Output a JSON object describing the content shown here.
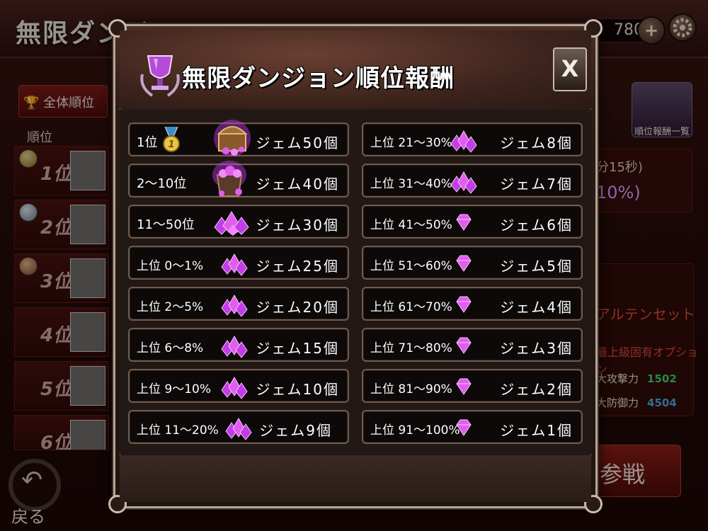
{
  "background": {
    "title": "無限ダンジョン",
    "counter": "780",
    "plus_label": "+",
    "all_rank_tab": "全体順位",
    "rank_header": "順位",
    "ranks": [
      "1位",
      "2位",
      "3位",
      "4位",
      "5位",
      "6位"
    ],
    "reward_list_button": "順位報酬一覧",
    "timer_text": "分15秒)",
    "percent_text": "10%)",
    "equip_name": "アルテンセット",
    "equip_option": "最上級固有オプション",
    "stats": [
      {
        "label": "大攻撃力",
        "value": "1502",
        "color": "#3fd06a"
      },
      {
        "label": "大防御力",
        "value": "4504",
        "color": "#4aa8e8"
      }
    ],
    "battle_button": "参戦",
    "back_button": "戻る"
  },
  "modal": {
    "title": "無限ダンジョン順位報酬",
    "close_label": "X",
    "left_rewards": [
      {
        "rank": "1位",
        "reward": "ジェム50個",
        "icon": "chest-gems-icon"
      },
      {
        "rank": "2〜10位",
        "reward": "ジェム40個",
        "icon": "pot-gems-icon"
      },
      {
        "rank": "11〜50位",
        "reward": "ジェム30個",
        "icon": "gem-pile-icon"
      },
      {
        "rank": "上位 0〜1%",
        "reward": "ジェム25個",
        "icon": "gem-cluster-icon"
      },
      {
        "rank": "上位 2〜5%",
        "reward": "ジェム20個",
        "icon": "gem-cluster-icon"
      },
      {
        "rank": "上位 6〜8%",
        "reward": "ジェム15個",
        "icon": "gem-cluster-icon"
      },
      {
        "rank": "上位 9〜10%",
        "reward": "ジェム10個",
        "icon": "gem-cluster-icon"
      },
      {
        "rank": "上位 11〜20%",
        "reward": "ジェム9個",
        "icon": "gem-cluster-icon"
      }
    ],
    "right_rewards": [
      {
        "rank": "上位 21〜30%",
        "reward": "ジェム8個",
        "icon": "gem-cluster-icon"
      },
      {
        "rank": "上位 31〜40%",
        "reward": "ジェム7個",
        "icon": "gem-cluster-icon"
      },
      {
        "rank": "上位 41〜50%",
        "reward": "ジェム6個",
        "icon": "gem-single-icon"
      },
      {
        "rank": "上位 51〜60%",
        "reward": "ジェム5個",
        "icon": "gem-single-icon"
      },
      {
        "rank": "上位 61〜70%",
        "reward": "ジェム4個",
        "icon": "gem-single-icon"
      },
      {
        "rank": "上位 71〜80%",
        "reward": "ジェム3個",
        "icon": "gem-single-icon"
      },
      {
        "rank": "上位 81〜90%",
        "reward": "ジェム2個",
        "icon": "gem-single-icon"
      },
      {
        "rank": "上位 91〜100%",
        "reward": "ジェム1個",
        "icon": "gem-single-icon"
      }
    ]
  },
  "colors": {
    "gem": "#e35cf0",
    "frame": "#b5a694",
    "row_bg": "#0d0908",
    "row_border": "#6e5b4d"
  }
}
